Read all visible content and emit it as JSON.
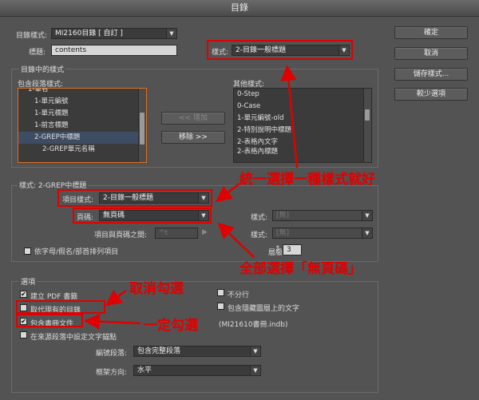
{
  "window": {
    "title": "目錄"
  },
  "buttons": {
    "ok": "確定",
    "cancel": "取消",
    "save_style": "儲存樣式...",
    "fewer_options": "較少選項",
    "add": "<< 增加",
    "remove": "移除 >>"
  },
  "top": {
    "toc_style_label": "目錄樣式:",
    "toc_style_value": "MI2160目錄 [ 自訂 ]",
    "title_label": "標題:",
    "title_value": "contents",
    "style_label": "樣式:",
    "style_value": "2-目錄一般標題"
  },
  "styles_group": {
    "title": "目錄中的樣式",
    "included_label": "包含段落樣式:",
    "included": [
      "1-章名",
      "1-單元編號",
      "1-單元標題",
      "1-前言標題",
      "2-GREP中標題",
      "2-GREP單元名稱"
    ],
    "other_label": "其他樣式:",
    "other": [
      "0-Step",
      "0-Case",
      "1-單元編號-old",
      "2-特別說明中標題",
      "2-表格內文字",
      "2-表格內標題"
    ]
  },
  "style_section": {
    "title": "樣式: 2-GREP中標題",
    "entry_style_label": "項目樣式:",
    "entry_style_value": "2-目錄一般標題",
    "page_number_label": "頁碼:",
    "page_number_value": "無頁碼",
    "between_label": "項目與頁碼之間:",
    "between_value": "^t",
    "style_right_label_1": "樣式:",
    "style_right_value_1": "[無]",
    "style_right_label_2": "樣式:",
    "style_right_value_2": "[無]",
    "level_label": "層級:",
    "level_value": "3",
    "sort_label": "依字母/假名/部首排列項目"
  },
  "options": {
    "title": "選項",
    "create_pdf": "建立 PDF 書籤",
    "replace_existing": "取代現有的目錄",
    "include_book": "包含書冊文件",
    "set_anchor": "在來源段落中設定文字錨點",
    "no_wrap": "不分行",
    "hidden_layers": "包含隱藏圖層上的文字",
    "book_file": "(MI21610書冊.indb)",
    "numbered_label": "編號段落:",
    "numbered_value": "包含完整段落",
    "frame_dir_label": "框架方向:",
    "frame_dir_value": "水平"
  },
  "annotations": {
    "unify": "統一選擇一種樣式就好",
    "select_all": "全部選擇「無頁碼」",
    "uncheck": "取消勾選",
    "must_check": "一定勾選"
  }
}
